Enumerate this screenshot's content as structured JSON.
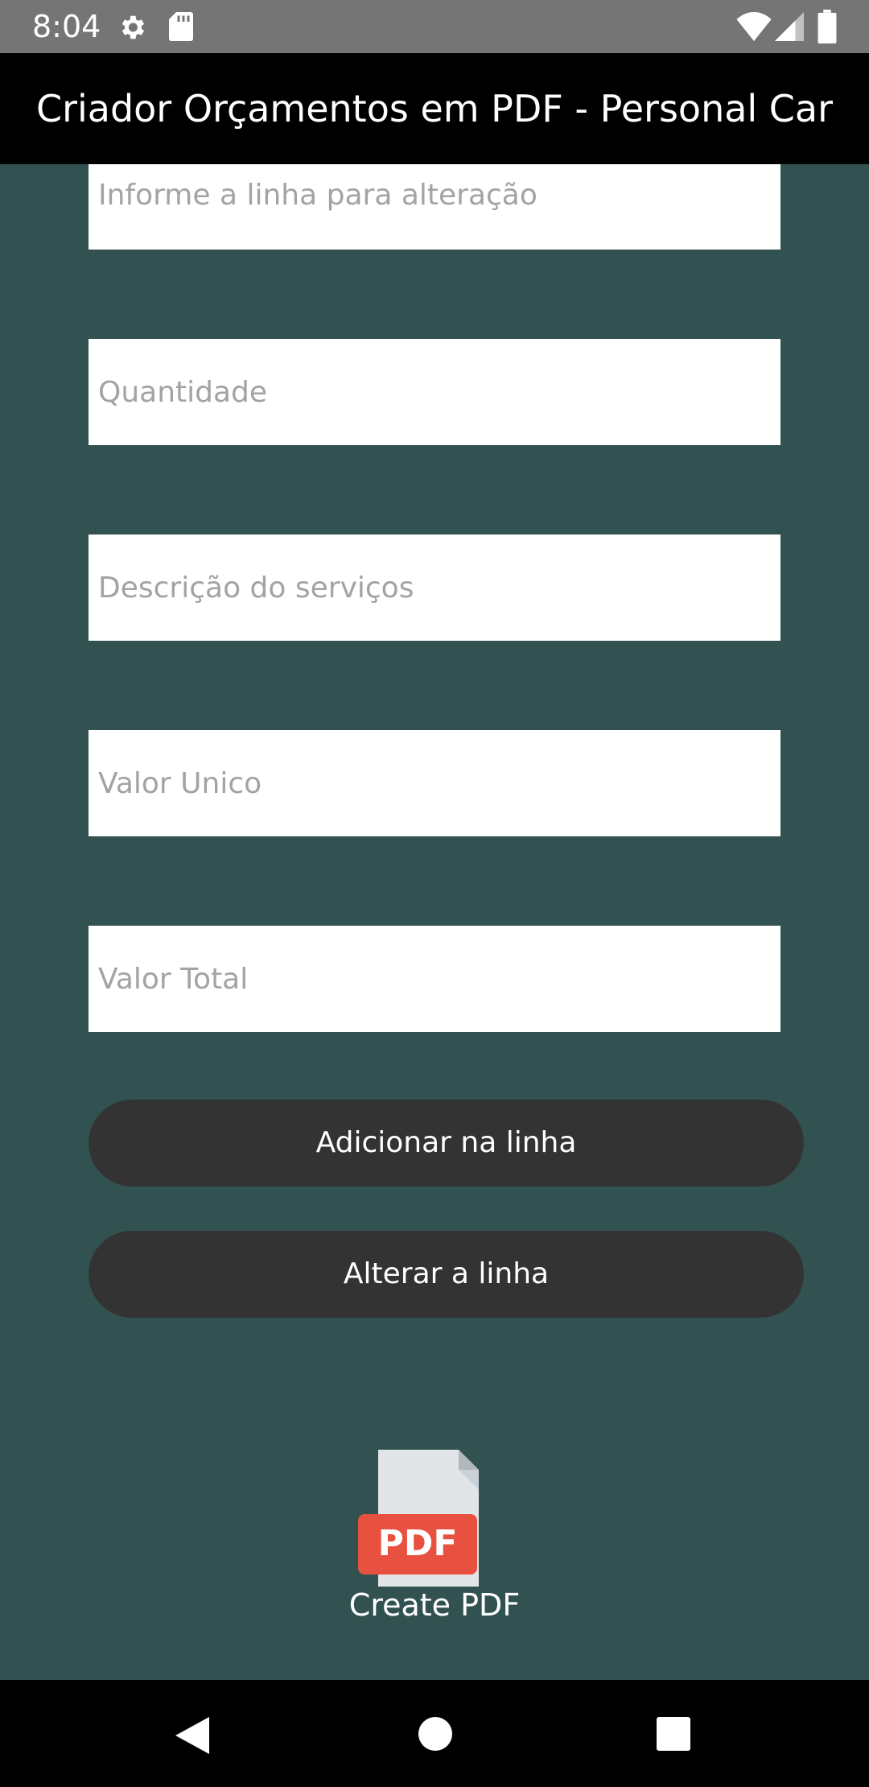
{
  "status_bar": {
    "time": "8:04",
    "icons": [
      "gear-icon",
      "sd-card-icon",
      "wifi-icon",
      "cell-signal-icon",
      "battery-icon"
    ]
  },
  "app_bar": {
    "title": "Criador Orçamentos em PDF - Personal Car"
  },
  "form": {
    "line_placeholder": "Informe a linha para alteração",
    "quantity_placeholder": "Quantidade",
    "description_placeholder": "Descrição do serviços",
    "unit_value_placeholder": "Valor Unico",
    "total_value_placeholder": "Valor Total"
  },
  "actions": {
    "add_label": "Adicionar na linha",
    "alter_label": "Alterar a linha"
  },
  "pdf": {
    "badge_text": "PDF",
    "label": "Create PDF",
    "badge_color": "#e8513f"
  },
  "nav_bar": {
    "icons": [
      "back-icon",
      "home-icon",
      "recents-icon"
    ]
  },
  "colors": {
    "background": "#325251",
    "app_bar": "#000000",
    "button": "#333333",
    "status_bar": "#757575"
  }
}
